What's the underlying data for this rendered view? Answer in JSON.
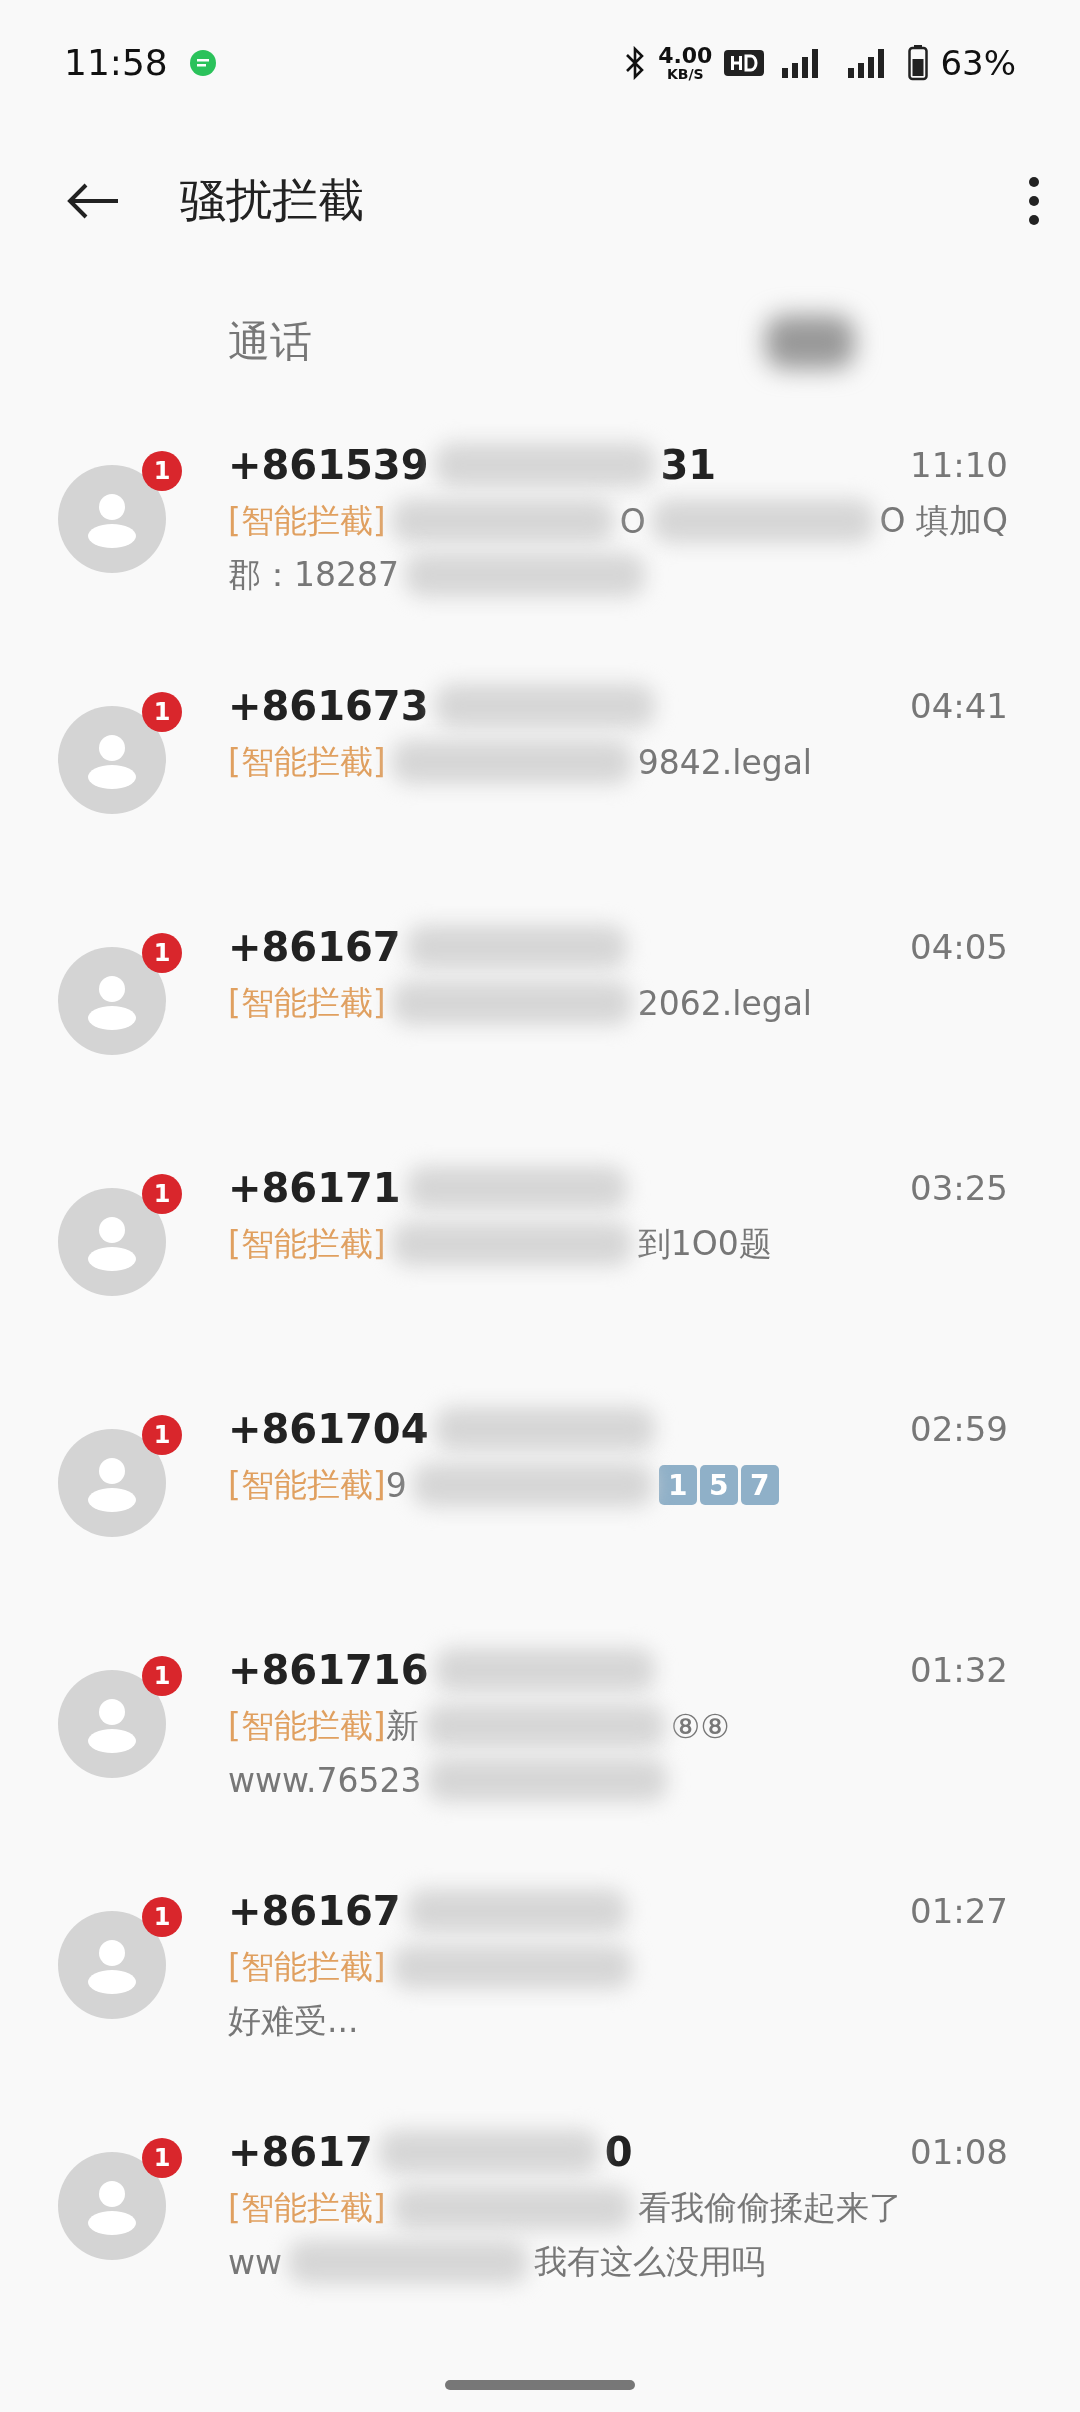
{
  "status_bar": {
    "time": "11:58",
    "speed_value": "4.00",
    "speed_unit": "KB/S",
    "battery": "63%"
  },
  "header": {
    "title": "骚扰拦截"
  },
  "tabs": [
    {
      "kind": "text",
      "label": "通话",
      "selected": false
    },
    {
      "kind": "redacted",
      "selected": true
    }
  ],
  "messages": [
    {
      "unread": "1",
      "number": [
        {
          "kind": "text",
          "text": "+861539"
        },
        {
          "kind": "redacted"
        },
        {
          "kind": "text",
          "text": "31"
        }
      ],
      "time": "11:10",
      "lines": [
        [
          {
            "kind": "tag",
            "text": "[智能拦截]"
          },
          {
            "kind": "redacted"
          },
          {
            "kind": "text",
            "text": "O"
          },
          {
            "kind": "redacted"
          },
          {
            "kind": "text",
            "text": "O  填加Q"
          }
        ],
        [
          {
            "kind": "text",
            "text": "郡：18287"
          },
          {
            "kind": "redacted"
          }
        ]
      ]
    },
    {
      "unread": "1",
      "number": [
        {
          "kind": "text",
          "text": "+861673"
        },
        {
          "kind": "redacted"
        }
      ],
      "time": "04:41",
      "lines": [
        [
          {
            "kind": "tag",
            "text": "[智能拦截]"
          },
          {
            "kind": "redacted"
          },
          {
            "kind": "text",
            "text": "9842.legal"
          }
        ]
      ]
    },
    {
      "unread": "1",
      "number": [
        {
          "kind": "text",
          "text": "+86167"
        },
        {
          "kind": "redacted"
        }
      ],
      "time": "04:05",
      "lines": [
        [
          {
            "kind": "tag",
            "text": "[智能拦截]"
          },
          {
            "kind": "redacted"
          },
          {
            "kind": "text",
            "text": "2062.legal"
          }
        ]
      ]
    },
    {
      "unread": "1",
      "number": [
        {
          "kind": "text",
          "text": "+86171"
        },
        {
          "kind": "redacted"
        }
      ],
      "time": "03:25",
      "lines": [
        [
          {
            "kind": "tag",
            "text": "[智能拦截]"
          },
          {
            "kind": "redacted"
          },
          {
            "kind": "text",
            "text": "到1O0题"
          }
        ]
      ]
    },
    {
      "unread": "1",
      "number": [
        {
          "kind": "text",
          "text": "+861704"
        },
        {
          "kind": "redacted"
        }
      ],
      "time": "02:59",
      "lines": [
        [
          {
            "kind": "tag",
            "text": "[智能拦截]"
          },
          {
            "kind": "text",
            "text": "9"
          },
          {
            "kind": "redacted"
          },
          {
            "kind": "keycap",
            "text": "1"
          },
          {
            "kind": "keycap",
            "text": "5"
          },
          {
            "kind": "keycap",
            "text": "7"
          }
        ]
      ]
    },
    {
      "unread": "1",
      "number": [
        {
          "kind": "text",
          "text": "+861716"
        },
        {
          "kind": "redacted"
        }
      ],
      "time": "01:32",
      "lines": [
        [
          {
            "kind": "tag",
            "text": "[智能拦截]"
          },
          {
            "kind": "text",
            "text": "新"
          },
          {
            "kind": "redacted"
          },
          {
            "kind": "text",
            "text": "⑧⑧"
          }
        ],
        [
          {
            "kind": "text",
            "text": "www.76523"
          },
          {
            "kind": "redacted"
          }
        ]
      ]
    },
    {
      "unread": "1",
      "number": [
        {
          "kind": "text",
          "text": "+86167"
        },
        {
          "kind": "redacted"
        }
      ],
      "time": "01:27",
      "lines": [
        [
          {
            "kind": "tag",
            "text": "[智能拦截]"
          },
          {
            "kind": "redacted"
          }
        ],
        [
          {
            "kind": "text",
            "text": "好难受..."
          }
        ]
      ]
    },
    {
      "unread": "1",
      "number": [
        {
          "kind": "text",
          "text": "+8617"
        },
        {
          "kind": "redacted"
        },
        {
          "kind": "text",
          "text": "0"
        }
      ],
      "time": "01:08",
      "lines": [
        [
          {
            "kind": "tag",
            "text": "[智能拦截]"
          },
          {
            "kind": "redacted"
          },
          {
            "kind": "text",
            "text": "看我偷偷揉起来了"
          }
        ],
        [
          {
            "kind": "text",
            "text": "ww"
          },
          {
            "kind": "redacted"
          },
          {
            "kind": "text",
            "text": "我有这么没用吗"
          }
        ]
      ]
    }
  ]
}
